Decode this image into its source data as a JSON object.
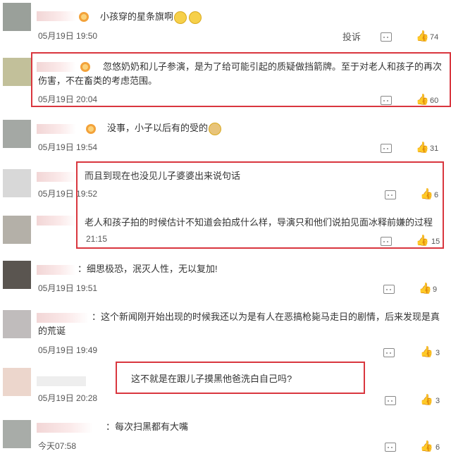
{
  "comments": [
    {
      "text": "小孩穿的星条旗啊",
      "time": "05月19日 19:50",
      "report": "投诉",
      "likes": "74"
    },
    {
      "text": "忽悠奶奶和儿子参演，是为了给可能引起的质疑做挡箭牌。至于对老人和孩子的再次伤害，不在畜类的考虑范围。",
      "time": "05月19日 20:04",
      "likes": "60"
    },
    {
      "text": "没事，小子以后有的受的",
      "time": "05月19日 19:54",
      "likes": "31"
    },
    {
      "text": "而且到现在也没见儿子婆婆出来说句话",
      "time": "05月19日 19:52",
      "likes": "6"
    },
    {
      "text": "老人和孩子拍的时候估计不知道会拍成什么样，导演只和他们说拍见面冰释前嫌的过程",
      "time": "21:15",
      "likes": "15"
    },
    {
      "text": "：细思极恐，泯灭人性，无以复加!",
      "time": "05月19日 19:51",
      "likes": "9"
    },
    {
      "text": "：这个新闻刚开始出现的时候我还以为是有人在恶搞枪毙马走日的剧情，后来发现是真的荒诞",
      "time": "05月19日 19:49",
      "likes": "3"
    },
    {
      "text": "这不就是在跟儿子摸黑他爸洗白自己吗?",
      "time": "05月19日 20:28",
      "likes": "3"
    },
    {
      "text": "：每次扫黑都有大嘴",
      "time": "今天07:58",
      "likes": "6"
    }
  ],
  "colors": {
    "highlight": "#d9363e",
    "text": "#333333",
    "meta": "#555555"
  }
}
